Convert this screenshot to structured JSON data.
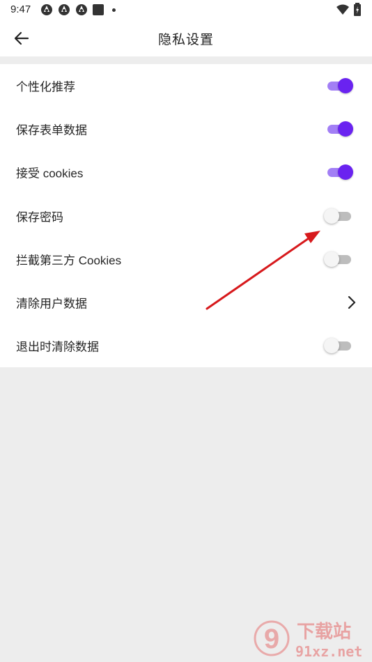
{
  "status_bar": {
    "time": "9:47",
    "icons": [
      "app-icon",
      "app-icon",
      "app-icon",
      "square-icon",
      "dot-icon",
      "wifi-icon",
      "battery-icon"
    ]
  },
  "app_bar": {
    "title": "隐私设置",
    "back_icon": "back-arrow-icon"
  },
  "settings": [
    {
      "label": "个性化推荐",
      "control": "toggle",
      "on": true
    },
    {
      "label": "保存表单数据",
      "control": "toggle",
      "on": true
    },
    {
      "label": "接受 cookies",
      "control": "toggle",
      "on": true
    },
    {
      "label": "保存密码",
      "control": "toggle",
      "on": false
    },
    {
      "label": "拦截第三方 Cookies",
      "control": "toggle",
      "on": false
    },
    {
      "label": "清除用户数据",
      "control": "chevron"
    },
    {
      "label": "退出时清除数据",
      "control": "toggle",
      "on": false
    }
  ],
  "colors": {
    "accent": "#6a23f0",
    "accent_track": "#a27ff5",
    "annotation_arrow": "#d7191c",
    "background": "#ededed"
  },
  "watermark": {
    "logo_text": "9",
    "name": "下载站",
    "domain": "91xz.net"
  }
}
